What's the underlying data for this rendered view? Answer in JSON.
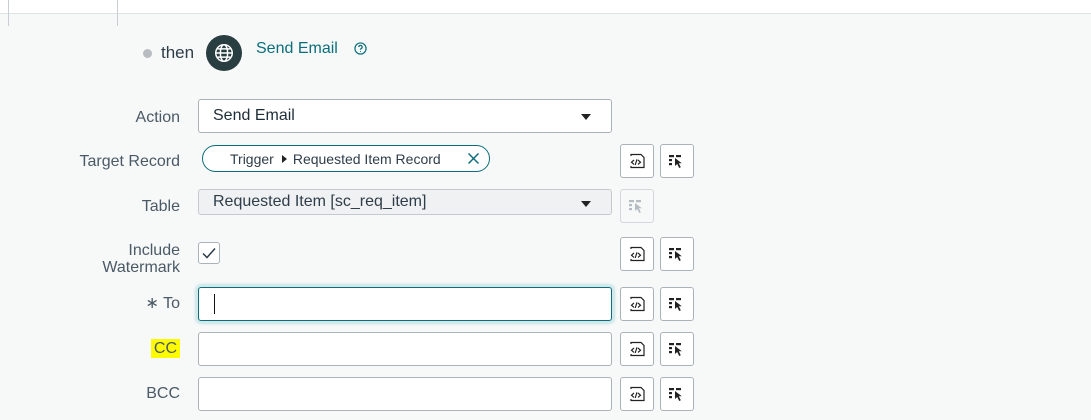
{
  "header": {
    "then_label": "then",
    "action_link": "Send Email",
    "action_icon": "globe-icon",
    "help_icon": "help-circle-icon"
  },
  "form": {
    "action": {
      "label": "Action",
      "value": "Send Email"
    },
    "target_record": {
      "label": "Target Record",
      "pill_segment_1": "Trigger",
      "pill_segment_2": "Requested Item Record"
    },
    "table": {
      "label": "Table",
      "value": "Requested Item [sc_req_item]"
    },
    "include_watermark": {
      "label_line1": "Include",
      "label_line2": "Watermark",
      "checked": true
    },
    "to": {
      "label": "∗ To",
      "value": ""
    },
    "cc": {
      "label": "CC",
      "value": ""
    },
    "bcc": {
      "label": "BCC",
      "value": ""
    }
  },
  "icons": {
    "script": "script-icon",
    "data_pill_picker": "data-pill-picker-icon"
  },
  "colors": {
    "accent": "#0b6e7a",
    "globe_bg": "#293e40",
    "highlight": "#fffb00"
  }
}
